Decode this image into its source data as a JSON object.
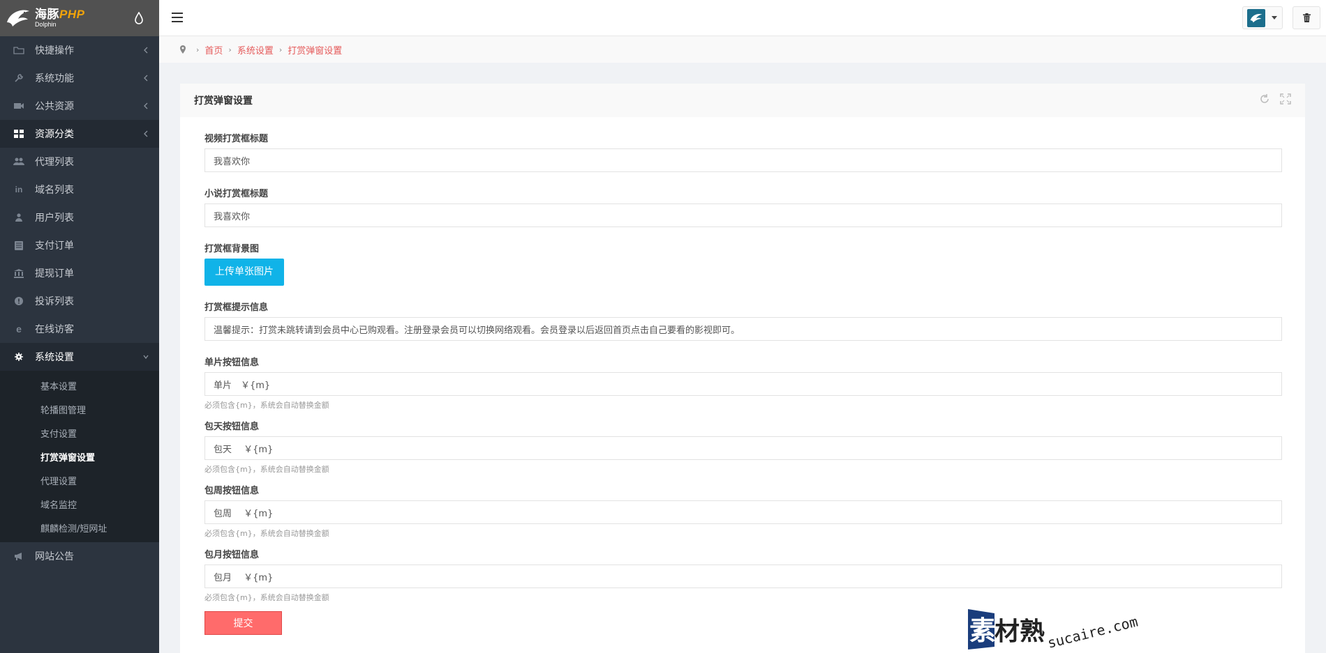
{
  "brand": {
    "name_main": "海豚",
    "name_php": "PHP",
    "name_sub": "Dolphin"
  },
  "sidebar": {
    "items": [
      {
        "label": "快捷操作",
        "icon": "folder-icon"
      },
      {
        "label": "系统功能",
        "icon": "wrench-icon"
      },
      {
        "label": "公共资源",
        "icon": "video-camera-icon"
      },
      {
        "label": "资源分类",
        "icon": "grid-icon"
      },
      {
        "label": "代理列表",
        "icon": "users-icon"
      },
      {
        "label": "域名列表",
        "icon": "linkedin-icon"
      },
      {
        "label": "用户列表",
        "icon": "user-icon"
      },
      {
        "label": "支付订单",
        "icon": "list-icon"
      },
      {
        "label": "提现订单",
        "icon": "bank-icon"
      },
      {
        "label": "投诉列表",
        "icon": "alert-icon"
      },
      {
        "label": "在线访客",
        "icon": "edge-icon"
      },
      {
        "label": "系统设置",
        "icon": "gear-icon"
      }
    ],
    "sub_items": [
      "基本设置",
      "轮播图管理",
      "支付设置",
      "打赏弹窗设置",
      "代理设置",
      "域名监控",
      "麒麟检测/短网址"
    ],
    "last_item": {
      "label": "网站公告",
      "icon": "bullhorn-icon"
    }
  },
  "breadcrumb": [
    "首页",
    "系统设置",
    "打赏弹窗设置"
  ],
  "card": {
    "title": "打赏弹窗设置"
  },
  "form": {
    "video_title": {
      "label": "视频打赏框标题",
      "value": "我喜欢你"
    },
    "novel_title": {
      "label": "小说打赏框标题",
      "value": "我喜欢你"
    },
    "bg_image": {
      "label": "打赏框背景图",
      "button": "上传单张图片"
    },
    "tip": {
      "label": "打赏框提示信息",
      "value": "温馨提示：打赏未跳转请到会员中心已购观看。注册登录会员可以切换网络观看。会员登录以后返回首页点击自己要看的影视即可。"
    },
    "single": {
      "label": "单片按钮信息",
      "value": "单片　￥{m}",
      "help": "必须包含{m}，系统会自动替换金额"
    },
    "day": {
      "label": "包天按钮信息",
      "value": "包天　 ￥{m}",
      "help": "必须包含{m}，系统会自动替换金额"
    },
    "week": {
      "label": "包周按钮信息",
      "value": "包周　 ￥{m}",
      "help": "必须包含{m}，系统会自动替换金额"
    },
    "month": {
      "label": "包月按钮信息",
      "value": "包月　 ￥{m}",
      "help": "必须包含{m}，系统会自动替换金额"
    },
    "submit": "提交"
  },
  "watermark": {
    "cn": "素材熟",
    "en": "sucaire.com"
  },
  "colors": {
    "accent": "#e55a5a",
    "upload": "#10b3e8",
    "submit": "#ff6b6b",
    "sidebar": "#2c343f"
  }
}
